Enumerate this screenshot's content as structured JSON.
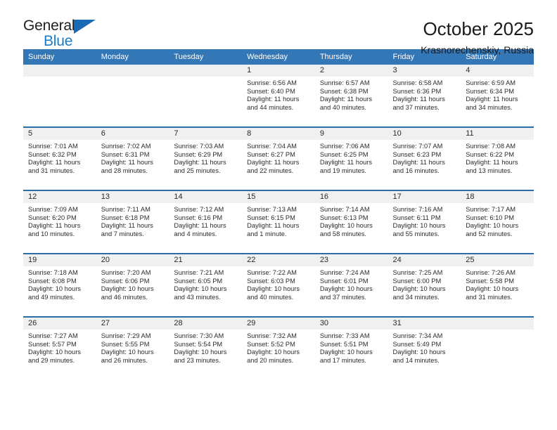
{
  "logo": {
    "line1": "General",
    "line2": "Blue",
    "triangle_color": "#1a6bb5",
    "blue_color": "#1a7bc4"
  },
  "header": {
    "title": "October 2025",
    "subtitle": "Krasnorechenskiy, Russia"
  },
  "theme": {
    "header_bg": "#3477b6",
    "row_divider": "#2d6ca8",
    "daynum_bg": "#f0f0f0",
    "text": "#2b2b2b"
  },
  "weekdays": [
    "Sunday",
    "Monday",
    "Tuesday",
    "Wednesday",
    "Thursday",
    "Friday",
    "Saturday"
  ],
  "labels": {
    "sunrise": "Sunrise:",
    "sunset": "Sunset:",
    "daylight": "Daylight:"
  },
  "weeks": [
    [
      {
        "day": "",
        "sunrise": "",
        "sunset": "",
        "daylight1": "",
        "daylight2": ""
      },
      {
        "day": "",
        "sunrise": "",
        "sunset": "",
        "daylight1": "",
        "daylight2": ""
      },
      {
        "day": "",
        "sunrise": "",
        "sunset": "",
        "daylight1": "",
        "daylight2": ""
      },
      {
        "day": "1",
        "sunrise": "Sunrise: 6:56 AM",
        "sunset": "Sunset: 6:40 PM",
        "daylight1": "Daylight: 11 hours",
        "daylight2": "and 44 minutes."
      },
      {
        "day": "2",
        "sunrise": "Sunrise: 6:57 AM",
        "sunset": "Sunset: 6:38 PM",
        "daylight1": "Daylight: 11 hours",
        "daylight2": "and 40 minutes."
      },
      {
        "day": "3",
        "sunrise": "Sunrise: 6:58 AM",
        "sunset": "Sunset: 6:36 PM",
        "daylight1": "Daylight: 11 hours",
        "daylight2": "and 37 minutes."
      },
      {
        "day": "4",
        "sunrise": "Sunrise: 6:59 AM",
        "sunset": "Sunset: 6:34 PM",
        "daylight1": "Daylight: 11 hours",
        "daylight2": "and 34 minutes."
      }
    ],
    [
      {
        "day": "5",
        "sunrise": "Sunrise: 7:01 AM",
        "sunset": "Sunset: 6:32 PM",
        "daylight1": "Daylight: 11 hours",
        "daylight2": "and 31 minutes."
      },
      {
        "day": "6",
        "sunrise": "Sunrise: 7:02 AM",
        "sunset": "Sunset: 6:31 PM",
        "daylight1": "Daylight: 11 hours",
        "daylight2": "and 28 minutes."
      },
      {
        "day": "7",
        "sunrise": "Sunrise: 7:03 AM",
        "sunset": "Sunset: 6:29 PM",
        "daylight1": "Daylight: 11 hours",
        "daylight2": "and 25 minutes."
      },
      {
        "day": "8",
        "sunrise": "Sunrise: 7:04 AM",
        "sunset": "Sunset: 6:27 PM",
        "daylight1": "Daylight: 11 hours",
        "daylight2": "and 22 minutes."
      },
      {
        "day": "9",
        "sunrise": "Sunrise: 7:06 AM",
        "sunset": "Sunset: 6:25 PM",
        "daylight1": "Daylight: 11 hours",
        "daylight2": "and 19 minutes."
      },
      {
        "day": "10",
        "sunrise": "Sunrise: 7:07 AM",
        "sunset": "Sunset: 6:23 PM",
        "daylight1": "Daylight: 11 hours",
        "daylight2": "and 16 minutes."
      },
      {
        "day": "11",
        "sunrise": "Sunrise: 7:08 AM",
        "sunset": "Sunset: 6:22 PM",
        "daylight1": "Daylight: 11 hours",
        "daylight2": "and 13 minutes."
      }
    ],
    [
      {
        "day": "12",
        "sunrise": "Sunrise: 7:09 AM",
        "sunset": "Sunset: 6:20 PM",
        "daylight1": "Daylight: 11 hours",
        "daylight2": "and 10 minutes."
      },
      {
        "day": "13",
        "sunrise": "Sunrise: 7:11 AM",
        "sunset": "Sunset: 6:18 PM",
        "daylight1": "Daylight: 11 hours",
        "daylight2": "and 7 minutes."
      },
      {
        "day": "14",
        "sunrise": "Sunrise: 7:12 AM",
        "sunset": "Sunset: 6:16 PM",
        "daylight1": "Daylight: 11 hours",
        "daylight2": "and 4 minutes."
      },
      {
        "day": "15",
        "sunrise": "Sunrise: 7:13 AM",
        "sunset": "Sunset: 6:15 PM",
        "daylight1": "Daylight: 11 hours",
        "daylight2": "and 1 minute."
      },
      {
        "day": "16",
        "sunrise": "Sunrise: 7:14 AM",
        "sunset": "Sunset: 6:13 PM",
        "daylight1": "Daylight: 10 hours",
        "daylight2": "and 58 minutes."
      },
      {
        "day": "17",
        "sunrise": "Sunrise: 7:16 AM",
        "sunset": "Sunset: 6:11 PM",
        "daylight1": "Daylight: 10 hours",
        "daylight2": "and 55 minutes."
      },
      {
        "day": "18",
        "sunrise": "Sunrise: 7:17 AM",
        "sunset": "Sunset: 6:10 PM",
        "daylight1": "Daylight: 10 hours",
        "daylight2": "and 52 minutes."
      }
    ],
    [
      {
        "day": "19",
        "sunrise": "Sunrise: 7:18 AM",
        "sunset": "Sunset: 6:08 PM",
        "daylight1": "Daylight: 10 hours",
        "daylight2": "and 49 minutes."
      },
      {
        "day": "20",
        "sunrise": "Sunrise: 7:20 AM",
        "sunset": "Sunset: 6:06 PM",
        "daylight1": "Daylight: 10 hours",
        "daylight2": "and 46 minutes."
      },
      {
        "day": "21",
        "sunrise": "Sunrise: 7:21 AM",
        "sunset": "Sunset: 6:05 PM",
        "daylight1": "Daylight: 10 hours",
        "daylight2": "and 43 minutes."
      },
      {
        "day": "22",
        "sunrise": "Sunrise: 7:22 AM",
        "sunset": "Sunset: 6:03 PM",
        "daylight1": "Daylight: 10 hours",
        "daylight2": "and 40 minutes."
      },
      {
        "day": "23",
        "sunrise": "Sunrise: 7:24 AM",
        "sunset": "Sunset: 6:01 PM",
        "daylight1": "Daylight: 10 hours",
        "daylight2": "and 37 minutes."
      },
      {
        "day": "24",
        "sunrise": "Sunrise: 7:25 AM",
        "sunset": "Sunset: 6:00 PM",
        "daylight1": "Daylight: 10 hours",
        "daylight2": "and 34 minutes."
      },
      {
        "day": "25",
        "sunrise": "Sunrise: 7:26 AM",
        "sunset": "Sunset: 5:58 PM",
        "daylight1": "Daylight: 10 hours",
        "daylight2": "and 31 minutes."
      }
    ],
    [
      {
        "day": "26",
        "sunrise": "Sunrise: 7:27 AM",
        "sunset": "Sunset: 5:57 PM",
        "daylight1": "Daylight: 10 hours",
        "daylight2": "and 29 minutes."
      },
      {
        "day": "27",
        "sunrise": "Sunrise: 7:29 AM",
        "sunset": "Sunset: 5:55 PM",
        "daylight1": "Daylight: 10 hours",
        "daylight2": "and 26 minutes."
      },
      {
        "day": "28",
        "sunrise": "Sunrise: 7:30 AM",
        "sunset": "Sunset: 5:54 PM",
        "daylight1": "Daylight: 10 hours",
        "daylight2": "and 23 minutes."
      },
      {
        "day": "29",
        "sunrise": "Sunrise: 7:32 AM",
        "sunset": "Sunset: 5:52 PM",
        "daylight1": "Daylight: 10 hours",
        "daylight2": "and 20 minutes."
      },
      {
        "day": "30",
        "sunrise": "Sunrise: 7:33 AM",
        "sunset": "Sunset: 5:51 PM",
        "daylight1": "Daylight: 10 hours",
        "daylight2": "and 17 minutes."
      },
      {
        "day": "31",
        "sunrise": "Sunrise: 7:34 AM",
        "sunset": "Sunset: 5:49 PM",
        "daylight1": "Daylight: 10 hours",
        "daylight2": "and 14 minutes."
      },
      {
        "day": "",
        "sunrise": "",
        "sunset": "",
        "daylight1": "",
        "daylight2": ""
      }
    ]
  ]
}
